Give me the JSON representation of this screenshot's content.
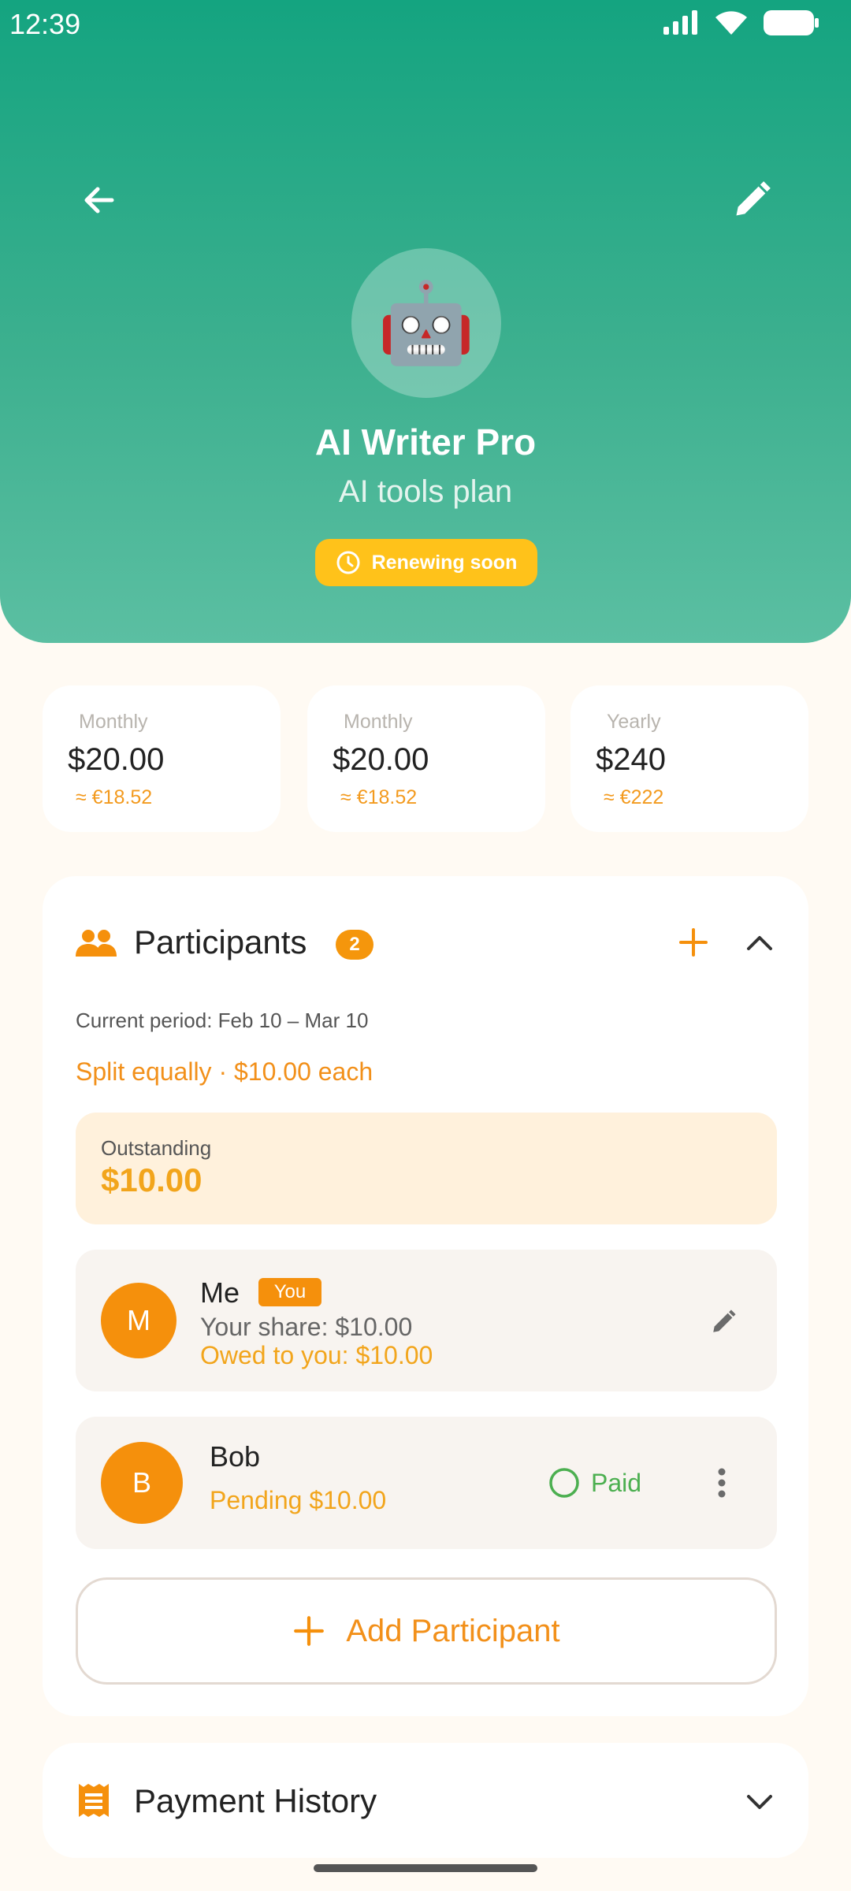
{
  "status_bar": {
    "time": "12:39"
  },
  "header": {
    "app_icon": "robot-emoji",
    "app_emoji": "🤖",
    "title": "AI Writer Pro",
    "subtitle": "AI tools plan",
    "badge": "Renewing soon"
  },
  "price_cards": [
    {
      "label": "Monthly",
      "amount": "$20.00",
      "converted": "≈ €18.52"
    },
    {
      "label": "Monthly",
      "amount": "$20.00",
      "converted": "≈ €18.52"
    },
    {
      "label": "Yearly",
      "amount": "$240",
      "converted": "≈ €222"
    }
  ],
  "participants": {
    "title": "Participants",
    "count": "2",
    "period": "Current period: Feb 10 – Mar 10",
    "split": "Split equally · $10.00 each",
    "outstanding_label": "Outstanding",
    "outstanding_value": "$10.00",
    "people": [
      {
        "initial": "M",
        "name": "Me",
        "badge": "You",
        "share": "Your share: $10.00",
        "owed": "Owed to you: $10.00"
      },
      {
        "initial": "B",
        "name": "Bob",
        "pending": "Pending $10.00",
        "paid_label": "Paid"
      }
    ],
    "add_button": "Add Participant"
  },
  "payment_history": {
    "title": "Payment History"
  },
  "colors": {
    "header_green": "#14a480",
    "accent_orange": "#f5900c",
    "badge_yellow": "#ffc21a",
    "paid_green": "#4caf50"
  }
}
